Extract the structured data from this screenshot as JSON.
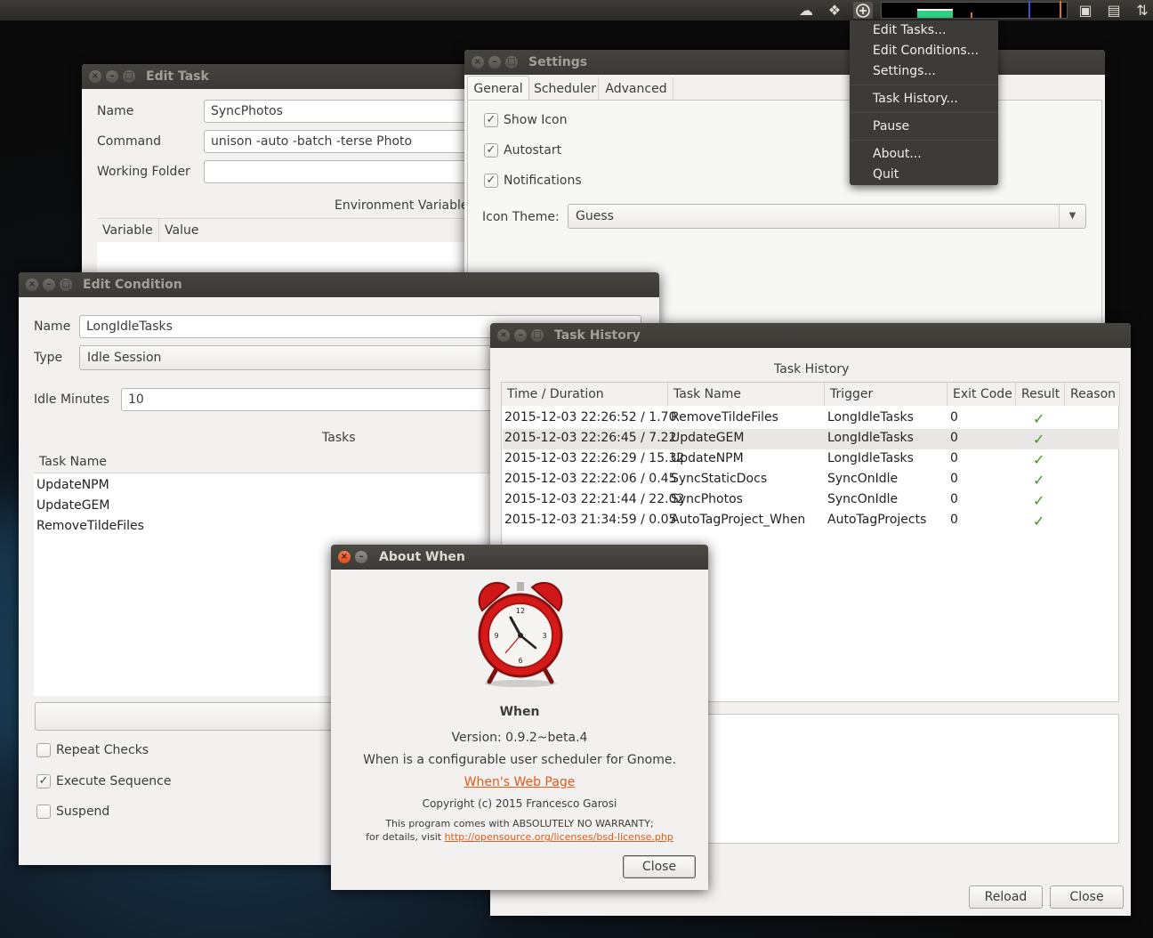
{
  "top_panel": {
    "tray_icons": [
      "cloud-sync-icon",
      "dropbox-icon",
      "alarm-clock-tray-icon",
      "system-monitor",
      "keyboard-icon",
      "notes-icon",
      "network-icon"
    ]
  },
  "tray_menu": {
    "items": [
      "Edit Tasks...",
      "Edit Conditions...",
      "Settings...",
      "Task History...",
      "Pause",
      "About...",
      "Quit"
    ]
  },
  "edit_task": {
    "title": "Edit Task",
    "name_label": "Name",
    "name_value": "SyncPhotos",
    "command_label": "Command",
    "command_value": "unison -auto -batch -terse Photo",
    "working_folder_label": "Working Folder",
    "working_folder_value": "",
    "env_section": "Environment Variable",
    "env_columns": [
      "Variable",
      "Value"
    ]
  },
  "settings": {
    "title": "Settings",
    "tabs": [
      "General",
      "Scheduler",
      "Advanced"
    ],
    "checkboxes": [
      {
        "label": "Show Icon",
        "checked": true
      },
      {
        "label": "Autostart",
        "checked": true
      },
      {
        "label": "Notifications",
        "checked": true
      }
    ],
    "icon_theme_label": "Icon Theme:",
    "icon_theme_value": "Guess"
  },
  "edit_condition": {
    "title": "Edit Condition",
    "name_label": "Name",
    "name_value": "LongIdleTasks",
    "type_label": "Type",
    "type_value": "Idle Session",
    "idle_minutes_label": "Idle Minutes",
    "idle_minutes_value": "10",
    "tasks_section": "Tasks",
    "task_column": "Task Name",
    "tasks": [
      "UpdateNPM",
      "UpdateGEM",
      "RemoveTildeFiles"
    ],
    "repeat_checks": "Repeat Checks",
    "execute_sequence": "Execute Sequence",
    "suspend": "Suspend"
  },
  "task_history": {
    "title": "Task History",
    "heading": "Task History",
    "columns": [
      "Time / Duration",
      "Task Name",
      "Trigger",
      "Exit Code",
      "Result",
      "Reason"
    ],
    "rows": [
      {
        "time": "2015-12-03 22:26:52 / 1.70",
        "task": "RemoveTildeFiles",
        "trigger": "LongIdleTasks",
        "exit": "0",
        "result": "✓"
      },
      {
        "time": "2015-12-03 22:26:45 / 7.22",
        "task": "UpdateGEM",
        "trigger": "LongIdleTasks",
        "exit": "0",
        "result": "✓"
      },
      {
        "time": "2015-12-03 22:26:29 / 15.32",
        "task": "UpdateNPM",
        "trigger": "LongIdleTasks",
        "exit": "0",
        "result": "✓"
      },
      {
        "time": "2015-12-03 22:22:06 / 0.45",
        "task": "SyncStaticDocs",
        "trigger": "SyncOnIdle",
        "exit": "0",
        "result": "✓"
      },
      {
        "time": "2015-12-03 22:21:44 / 22.02",
        "task": "SyncPhotos",
        "trigger": "SyncOnIdle",
        "exit": "0",
        "result": "✓"
      },
      {
        "time": "2015-12-03 21:34:59 / 0.05",
        "task": "AutoTagProject_When",
        "trigger": "AutoTagProjects",
        "exit": "0",
        "result": "✓"
      }
    ],
    "reload_button": "Reload",
    "close_button": "Close"
  },
  "about": {
    "title": "About When",
    "app_name": "When",
    "version": "Version: 0.9.2~beta.4",
    "description": "When is a configurable user scheduler for Gnome.",
    "website": "When's Web Page",
    "copyright": "Copyright (c) 2015 Francesco Garosi",
    "warranty_line1": "This program comes with ABSOLUTELY NO WARRANTY;",
    "warranty_prefix": "for details, visit ",
    "license_url": "http://opensource.org/licenses/bsd-license.php",
    "close_button": "Close"
  },
  "colors": {
    "titlebar": "#3c3b37",
    "close_button": "#df4a16",
    "link": "#e05a1c",
    "check_green": "#3f9a1e",
    "menu_bg": "#3c3b37"
  }
}
